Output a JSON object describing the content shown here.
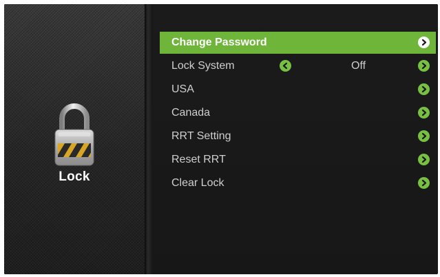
{
  "sidebar": {
    "title": "Lock",
    "icon": "padlock-icon"
  },
  "menu": {
    "items": [
      {
        "label": "Change Password",
        "selected": true,
        "value": "",
        "has_left_arrow": false
      },
      {
        "label": "Lock System",
        "selected": false,
        "value": "Off",
        "has_left_arrow": true
      },
      {
        "label": "USA",
        "selected": false,
        "value": "",
        "has_left_arrow": false
      },
      {
        "label": "Canada",
        "selected": false,
        "value": "",
        "has_left_arrow": false
      },
      {
        "label": "RRT Setting",
        "selected": false,
        "value": "",
        "has_left_arrow": false
      },
      {
        "label": "Reset RRT",
        "selected": false,
        "value": "",
        "has_left_arrow": false
      },
      {
        "label": "Clear Lock",
        "selected": false,
        "value": "",
        "has_left_arrow": false
      }
    ]
  },
  "colors": {
    "accent_green": "#6fb53a",
    "arrow_green": "#77c043",
    "background": "#171717"
  }
}
